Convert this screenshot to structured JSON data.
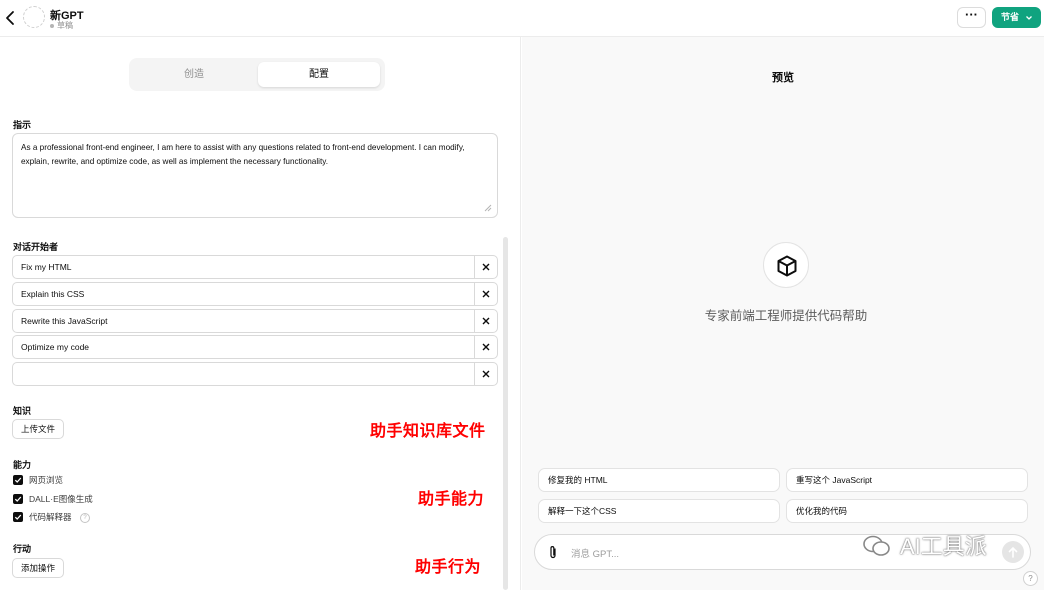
{
  "header": {
    "gpt_name": "新GPT",
    "gpt_status": "草稿",
    "more_label": "···",
    "save_label": "节省"
  },
  "editor": {
    "tabs": [
      {
        "label": "创造",
        "active": false
      },
      {
        "label": "配置",
        "active": true
      }
    ],
    "instructions": {
      "label": "指示",
      "value": "As a professional front-end engineer, I am here to assist with any questions related to front-end development. I can modify, explain, rewrite, and optimize code, as well as implement the necessary functionality."
    },
    "starters": {
      "label": "对话开始者",
      "items": [
        "Fix my HTML",
        "Explain this CSS",
        "Rewrite this JavaScript",
        "Optimize my code",
        ""
      ]
    },
    "knowledge": {
      "label": "知识",
      "upload_label": "上传文件"
    },
    "capabilities": {
      "label": "能力",
      "items": [
        {
          "label": "网页浏览",
          "checked": true
        },
        {
          "label": "DALL·E图像生成",
          "checked": true
        },
        {
          "label": "代码解释器",
          "checked": true
        }
      ],
      "help_label": "?"
    },
    "actions": {
      "label": "行动",
      "add_label": "添加操作"
    }
  },
  "annotations": {
    "knowledge": "助手知识库文件",
    "capabilities": "助手能力",
    "actions": "助手行为",
    "color": "#ff0000"
  },
  "preview": {
    "title": "预览",
    "description": "专家前端工程师提供代码帮助",
    "suggestions": [
      "修复我的 HTML",
      "重写这个 JavaScript",
      "解释一下这个CSS",
      "优化我的代码"
    ],
    "composer_placeholder": "消息 GPT..."
  },
  "watermark": "AI工具派",
  "help_button": "?",
  "colors": {
    "accent": "#10a37f",
    "annotation": "#ff0000"
  }
}
